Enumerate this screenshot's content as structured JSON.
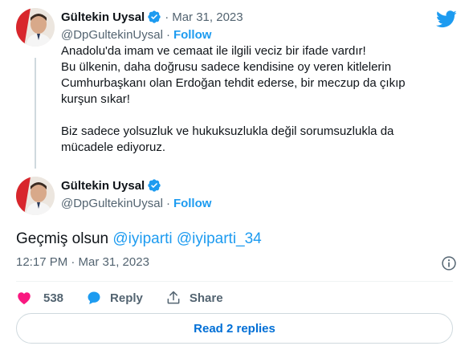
{
  "colors": {
    "accent": "#1d9bf0",
    "like": "#f91880",
    "text": "#0f1419",
    "muted": "#536471"
  },
  "icons": {
    "logo": "twitter-bird-icon",
    "verified": "verified-badge-icon",
    "info": "info-icon",
    "like": "heart-icon",
    "reply": "reply-bubble-icon",
    "share": "share-upload-icon"
  },
  "tweet1": {
    "name": "Gültekin Uysal",
    "date": "Mar 31, 2023",
    "handle": "@DpGultekinUysal",
    "follow": "Follow",
    "lines": [
      "Anadolu'da imam ve cemaat ile ilgili veciz bir ifade vardır!",
      "Bu ülkenin, daha doğrusu sadece kendisine oy veren kitlelerin",
      "Cumhurbaşkanı olan Erdoğan tehdit ederse, bir meczup da çıkıp",
      "kurşun sıkar!",
      "Biz sadece yolsuzluk ve hukuksuzlukla değil sorumsuzlukla da",
      "mücadele ediyoruz."
    ]
  },
  "tweet2": {
    "name": "Gültekin Uysal",
    "handle": "@DpGultekinUysal",
    "follow": "Follow",
    "text_plain": "Geçmiş olsun ",
    "mention1": "@iyiparti",
    "space": " ",
    "mention2": "@iyiparti_34",
    "timestamp": "12:17 PM · Mar 31, 2023"
  },
  "actions": {
    "likes": "538",
    "reply": "Reply",
    "share": "Share"
  },
  "read_replies": "Read 2 replies"
}
